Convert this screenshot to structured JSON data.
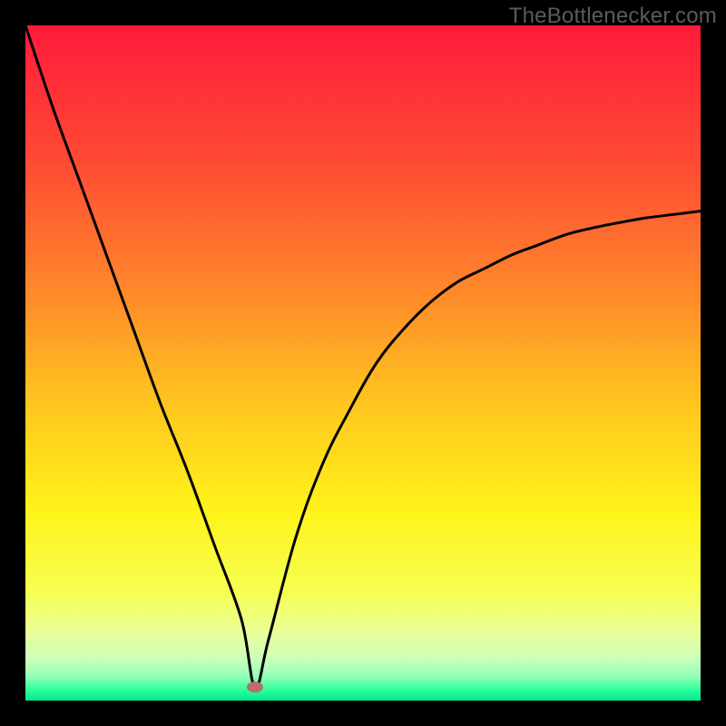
{
  "watermark": "TheBottlenecker.com",
  "colors": {
    "frame": "#000000",
    "curve": "#000000",
    "marker": "#bd6c6c",
    "gradient_stops": [
      {
        "offset": 0.0,
        "color": "#ff1a3a"
      },
      {
        "offset": 0.2,
        "color": "#ff4a33"
      },
      {
        "offset": 0.4,
        "color": "#ff8a2a"
      },
      {
        "offset": 0.55,
        "color": "#ffc21f"
      },
      {
        "offset": 0.72,
        "color": "#fff31a"
      },
      {
        "offset": 0.84,
        "color": "#f6ff52"
      },
      {
        "offset": 0.9,
        "color": "#e9ff9a"
      },
      {
        "offset": 0.94,
        "color": "#c9ffba"
      },
      {
        "offset": 0.965,
        "color": "#8fffb8"
      },
      {
        "offset": 0.985,
        "color": "#2aff9c"
      },
      {
        "offset": 1.0,
        "color": "#00e88a"
      }
    ]
  },
  "chart_data": {
    "type": "line",
    "title": "",
    "xlabel": "",
    "ylabel": "",
    "xlim": [
      0,
      100
    ],
    "ylim": [
      0,
      100
    ],
    "annotations": [
      "TheBottlenecker.com"
    ],
    "min_marker": {
      "x": 34,
      "y": 2
    },
    "series": [
      {
        "name": "bottleneck-curve",
        "x": [
          0,
          4,
          8,
          12,
          16,
          20,
          24,
          28,
          32,
          34,
          36,
          40,
          44,
          48,
          52,
          56,
          60,
          64,
          68,
          72,
          76,
          80,
          84,
          88,
          92,
          96,
          100
        ],
        "y": [
          100,
          88,
          77,
          66,
          55,
          44,
          34,
          23,
          12,
          2,
          9,
          24,
          35,
          43,
          50,
          55,
          59,
          62,
          64,
          66,
          67.5,
          69,
          70,
          70.8,
          71.5,
          72,
          72.5
        ]
      }
    ]
  }
}
